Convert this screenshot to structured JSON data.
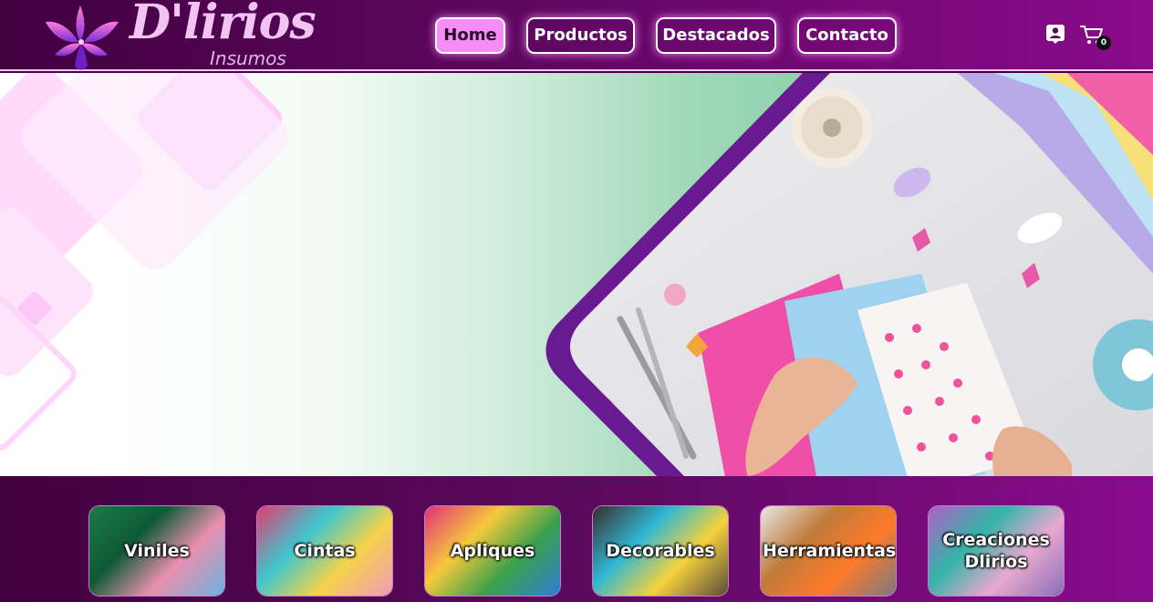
{
  "brand": {
    "name": "D'lirios",
    "subtitle": "Insumos"
  },
  "nav": {
    "items": [
      {
        "label": "Home",
        "active": true
      },
      {
        "label": "Productos",
        "active": false
      },
      {
        "label": "Destacados",
        "active": false
      },
      {
        "label": "Contacto",
        "active": false
      }
    ]
  },
  "header_icons": {
    "user": "user-account-icon",
    "cart": "shopping-cart-icon",
    "cart_count": "0"
  },
  "colors": {
    "header": "#5e0760",
    "accent": "#f68cf5",
    "hero_green": "#86cfa6",
    "frame_purple": "#6a1a90"
  },
  "categories": [
    {
      "label": "Viniles",
      "colors": [
        "#1b7a4a",
        "#0e5a35",
        "#e98fb0",
        "#6ab3e0"
      ]
    },
    {
      "label": "Cintas",
      "colors": [
        "#e63b6e",
        "#3fc5cf",
        "#f4d34a",
        "#f29ab7"
      ]
    },
    {
      "label": "Apliques",
      "colors": [
        "#e2307a",
        "#f6c93b",
        "#3aa14a",
        "#2f7ed8"
      ]
    },
    {
      "label": "Decorables",
      "colors": [
        "#3a2a28",
        "#2fb7d4",
        "#f5d23c",
        "#5a4a3a"
      ]
    },
    {
      "label": "Herramientas",
      "colors": [
        "#e8e8ea",
        "#c07a3a",
        "#ff7a2a",
        "#7a7a80"
      ]
    },
    {
      "label": "Creaciones Dlirios",
      "colors": [
        "#b05fc7",
        "#34b4a8",
        "#e8a8d0",
        "#8a6fb8"
      ]
    }
  ]
}
